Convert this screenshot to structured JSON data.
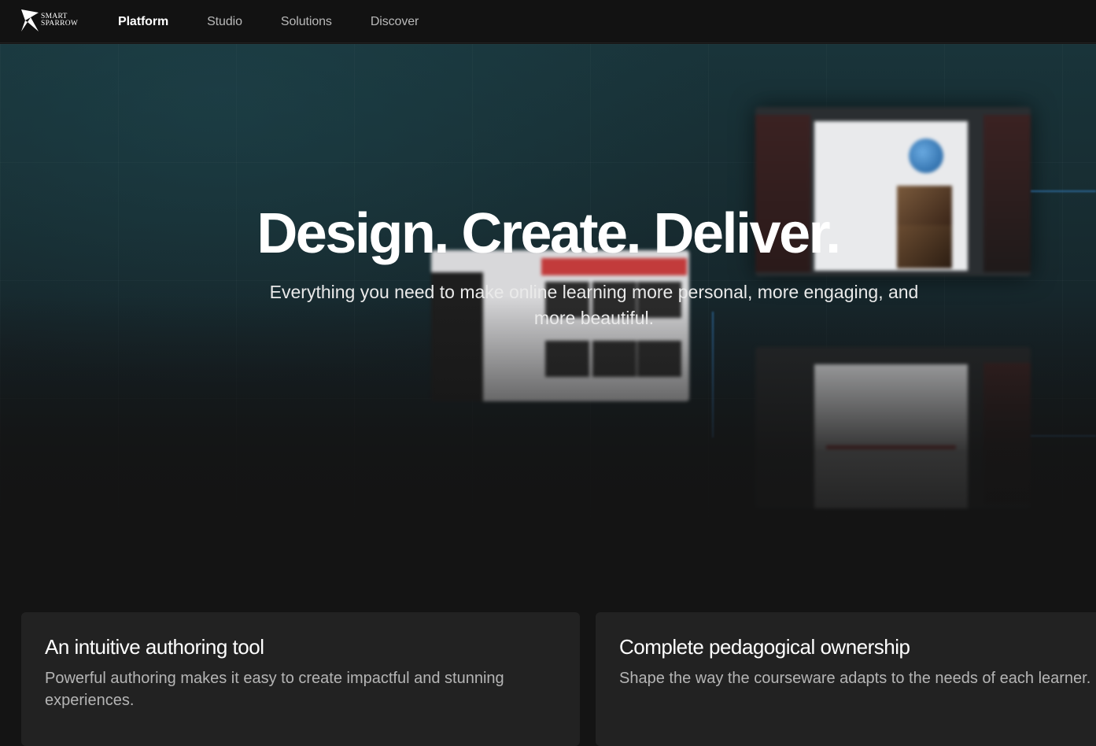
{
  "logo": {
    "line1": "SMART",
    "line2": "SPARROW",
    "icon": "sparrow-logo-icon"
  },
  "nav": {
    "items": [
      {
        "label": "Platform",
        "active": true
      },
      {
        "label": "Studio",
        "active": false
      },
      {
        "label": "Solutions",
        "active": false
      },
      {
        "label": "Discover",
        "active": false
      }
    ]
  },
  "hero": {
    "title": "Design. Create. Deliver.",
    "subtitle": "Everything you need to make online learning more personal, more engaging, and more beautiful."
  },
  "features": [
    {
      "title": "An intuitive authoring tool",
      "description": "Powerful authoring makes it easy to create impactful and stunning experiences."
    },
    {
      "title": "Complete pedagogical ownership",
      "description": "Shape the way the courseware adapts to the needs of each learner."
    }
  ],
  "colors": {
    "background": "#141414",
    "nav_background": "#121212",
    "card_background": "#222222",
    "hero_teal": "#19343a",
    "accent_blue": "#3c96e6",
    "accent_red": "#c23b3b"
  }
}
